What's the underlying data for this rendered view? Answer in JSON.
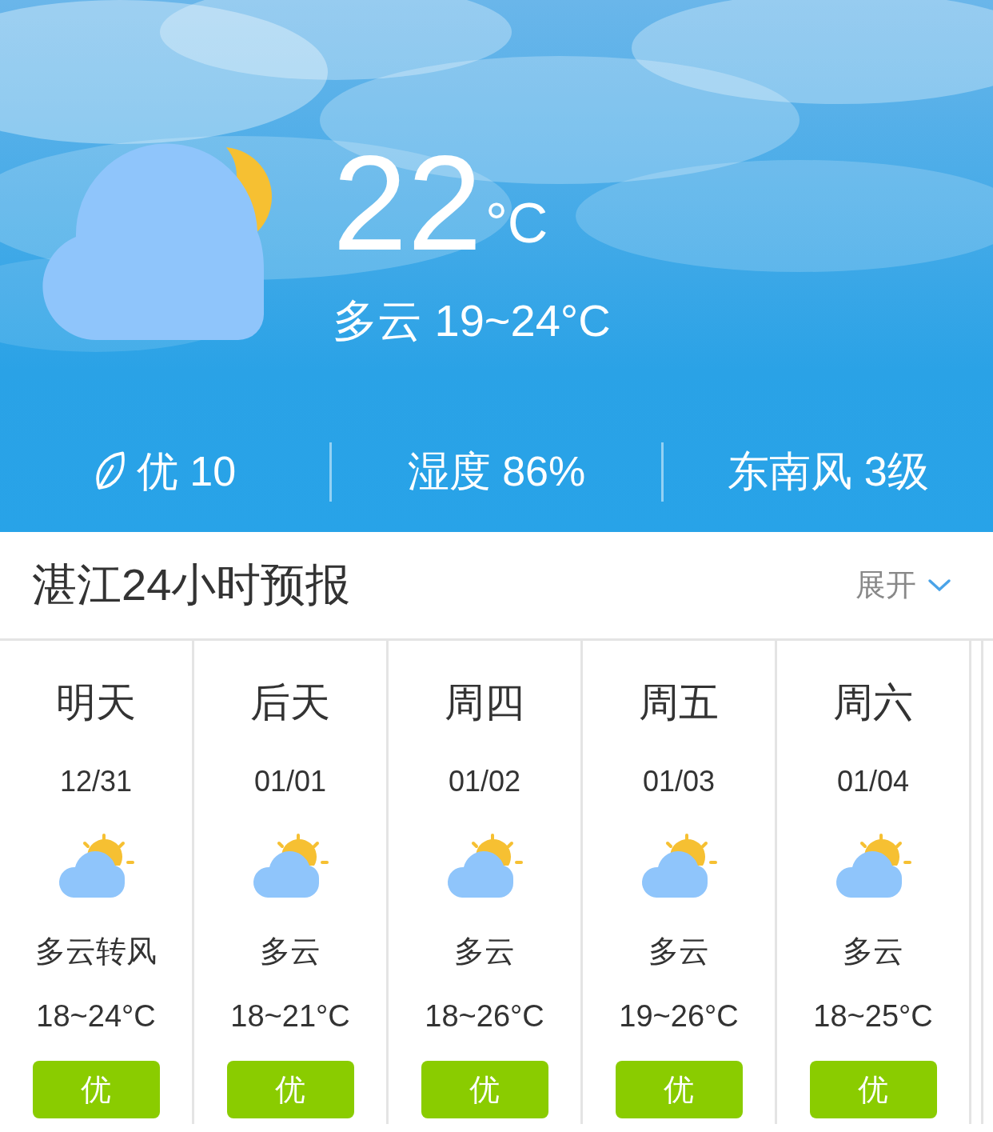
{
  "current": {
    "kind": "cloudy_night",
    "temperature": "22",
    "unit": "°C",
    "summary": "多云 19~24°C"
  },
  "stats": [
    {
      "kind": "aqi",
      "text": "优 10"
    },
    {
      "kind": "plain",
      "text": "湿度 86%"
    },
    {
      "kind": "plain",
      "text": "东南风 3级"
    }
  ],
  "forecast": {
    "title": "湛江24小时预报",
    "expand_label": "展开",
    "days": [
      {
        "day": "明天",
        "date": "12/31",
        "kind": "partly_cloudy",
        "condition": "多云转风",
        "temps": "18~24°C",
        "aqi": "优"
      },
      {
        "day": "后天",
        "date": "01/01",
        "kind": "partly_cloudy",
        "condition": "多云",
        "temps": "18~21°C",
        "aqi": "优"
      },
      {
        "day": "周四",
        "date": "01/02",
        "kind": "partly_cloudy",
        "condition": "多云",
        "temps": "18~26°C",
        "aqi": "优"
      },
      {
        "day": "周五",
        "date": "01/03",
        "kind": "partly_cloudy",
        "condition": "多云",
        "temps": "19~26°C",
        "aqi": "优"
      },
      {
        "day": "周六",
        "date": "01/04",
        "kind": "partly_cloudy",
        "condition": "多云",
        "temps": "18~25°C",
        "aqi": "优"
      }
    ]
  }
}
